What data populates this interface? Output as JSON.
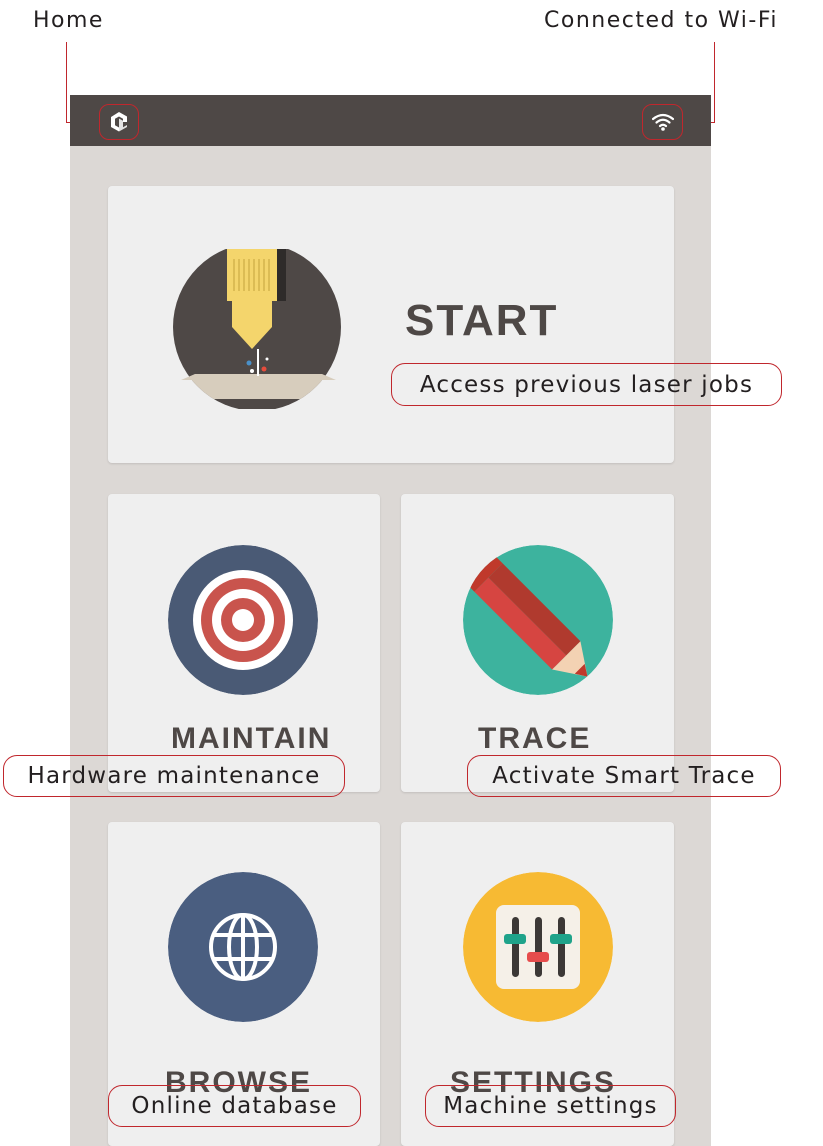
{
  "annotations": {
    "home": "Home",
    "wifi": "Connected to Wi-Fi"
  },
  "colors": {
    "accent_red": "#c0272d",
    "statusbar": "#4e4846",
    "background": "#dcd8d5",
    "card": "#efefef",
    "maintain_circle": "#4a5a75",
    "trace_circle": "#3db39e",
    "browse_circle": "#4a5e80",
    "settings_circle": "#f7ba33"
  },
  "statusbar": {
    "left_icon": "home-logo-icon",
    "right_icon": "wifi-icon"
  },
  "cards": {
    "start": {
      "title": "START",
      "subtitle": "Access previous laser jobs",
      "icon": "laser-head-icon"
    },
    "maintain": {
      "title": "MAINTAIN",
      "subtitle": "Hardware maintenance",
      "icon": "target-icon"
    },
    "trace": {
      "title": "TRACE",
      "subtitle": "Activate Smart Trace",
      "icon": "pencil-icon"
    },
    "browse": {
      "title": "BROWSE",
      "subtitle": "Online database",
      "icon": "globe-icon"
    },
    "settings": {
      "title": "SETTINGS",
      "subtitle": "Machine settings",
      "icon": "sliders-icon"
    }
  }
}
